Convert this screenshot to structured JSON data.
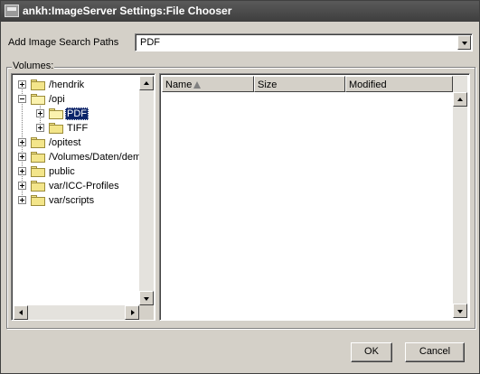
{
  "window": {
    "title": "ankh:ImageServer Settings:File Chooser"
  },
  "search_paths": {
    "label": "Add Image Search Paths",
    "value": "PDF"
  },
  "volumes": {
    "label": "Volumes:",
    "tree": [
      {
        "label": "/hendrik",
        "expanded": false
      },
      {
        "label": "/opi",
        "expanded": true
      },
      {
        "label": "PDF",
        "expanded": false,
        "selected": true
      },
      {
        "label": "TIFF",
        "expanded": false
      },
      {
        "label": "/opitest",
        "expanded": false
      },
      {
        "label": "/Volumes/Daten/dem",
        "expanded": false
      },
      {
        "label": "public",
        "expanded": false
      },
      {
        "label": "var/ICC-Profiles",
        "expanded": false
      },
      {
        "label": "var/scripts",
        "expanded": false
      }
    ]
  },
  "files": {
    "columns": [
      {
        "label": "Name"
      },
      {
        "label": "Size"
      },
      {
        "label": "Modified"
      }
    ],
    "sort": "Name ascending"
  },
  "buttons": {
    "ok": "OK",
    "cancel": "Cancel"
  },
  "colors": {
    "title_bar": "#4a4a4a",
    "selection": "#0a246a",
    "folder": "#f3e58a",
    "window_bg": "#d4d0c8"
  }
}
